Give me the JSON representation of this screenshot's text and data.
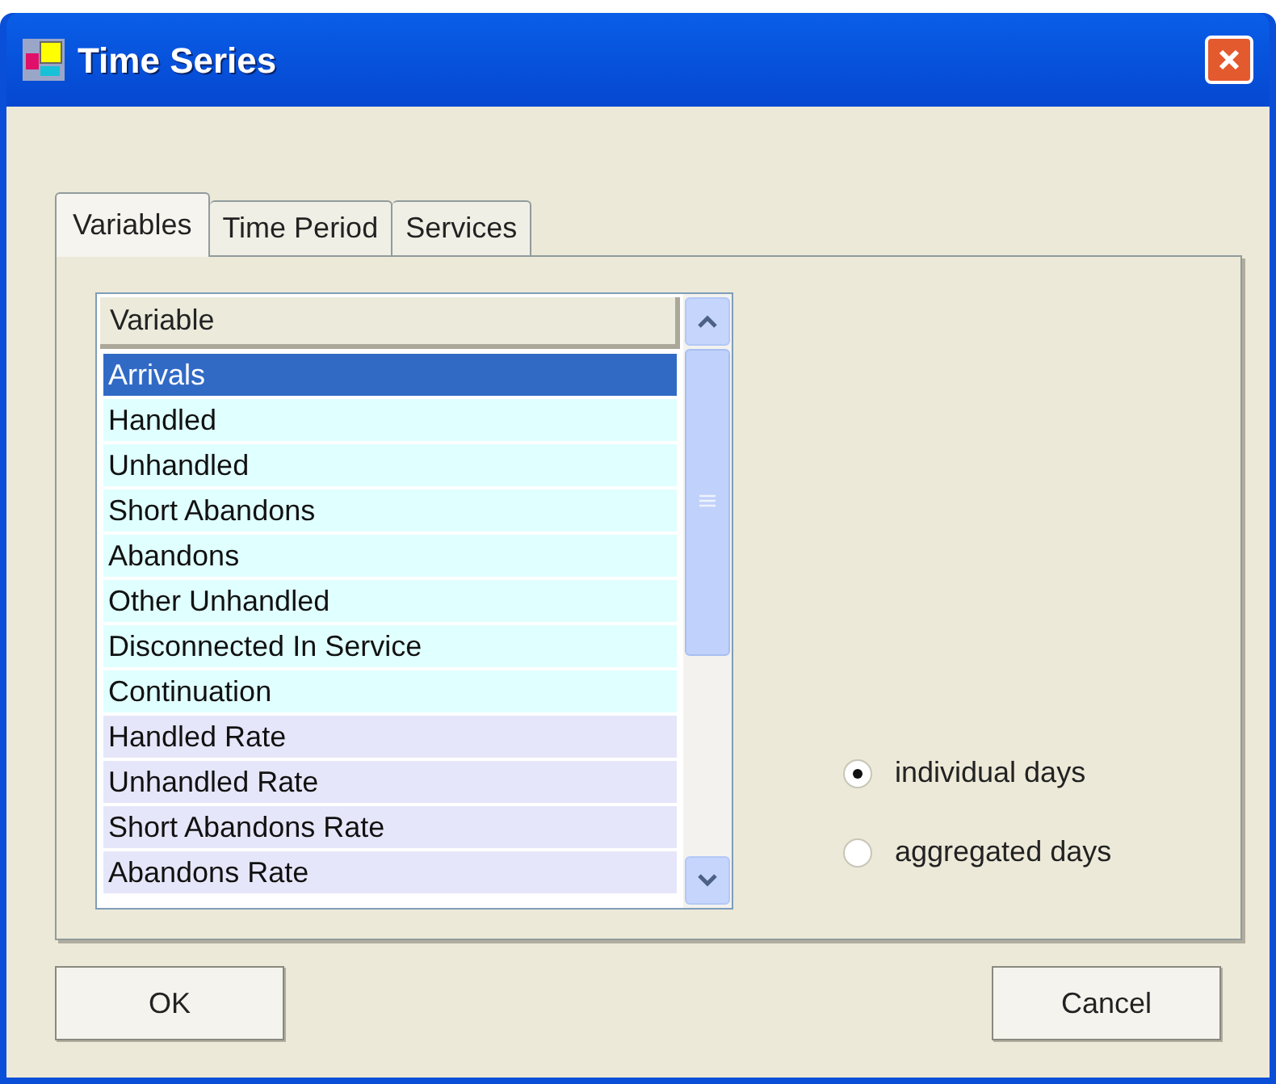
{
  "window": {
    "title": "Time Series"
  },
  "tabs": [
    {
      "label": "Variables",
      "selected": true
    },
    {
      "label": "Time Period",
      "selected": false
    },
    {
      "label": "Services",
      "selected": false
    }
  ],
  "list": {
    "column": "Variable",
    "rows": [
      {
        "label": "Arrivals",
        "selected": true
      },
      {
        "label": "Handled",
        "selected": false,
        "color": "#e0ffff"
      },
      {
        "label": "Unhandled",
        "selected": false,
        "color": "#e0ffff"
      },
      {
        "label": "Short Abandons",
        "selected": false,
        "color": "#e0ffff"
      },
      {
        "label": "Abandons",
        "selected": false,
        "color": "#e0ffff"
      },
      {
        "label": "Other Unhandled",
        "selected": false,
        "color": "#e0ffff"
      },
      {
        "label": "Disconnected In Service",
        "selected": false,
        "color": "#e0ffff"
      },
      {
        "label": "Continuation",
        "selected": false,
        "color": "#e0ffff"
      },
      {
        "label": "Handled Rate",
        "selected": false,
        "color": "#e6e6fa"
      },
      {
        "label": "Unhandled Rate",
        "selected": false,
        "color": "#e6e6fa"
      },
      {
        "label": "Short Abandons Rate",
        "selected": false,
        "color": "#e6e6fa"
      },
      {
        "label": "Abandons Rate",
        "selected": false,
        "color": "#e6e6fa"
      }
    ]
  },
  "options": [
    {
      "label": "individual days",
      "selected": true
    },
    {
      "label": "aggregated days",
      "selected": false
    }
  ],
  "buttons": [
    {
      "label": "OK"
    },
    {
      "label": "Cancel"
    }
  ]
}
